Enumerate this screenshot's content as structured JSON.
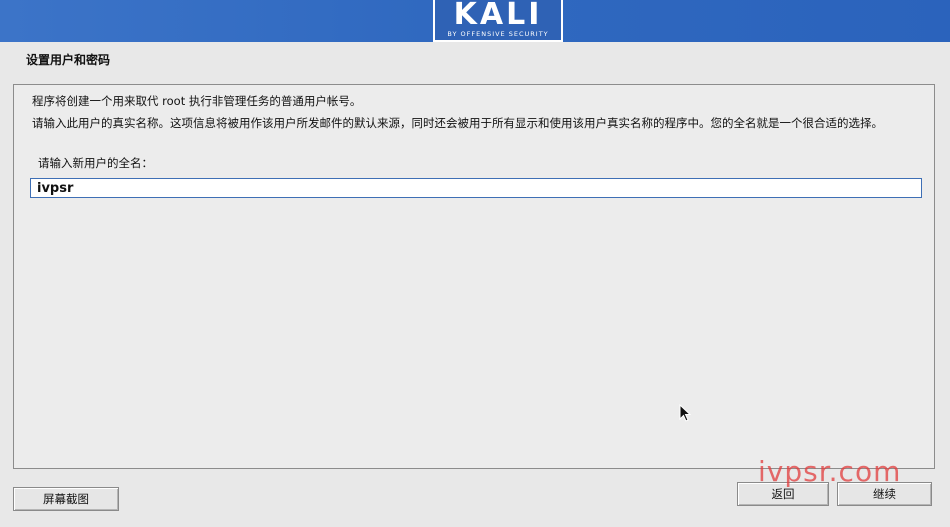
{
  "header": {
    "logo_text": "KALI",
    "logo_subtitle": "BY OFFENSIVE SECURITY"
  },
  "page": {
    "title": "设置用户和密码"
  },
  "content": {
    "intro": "程序将创建一个用来取代 root 执行非管理任务的普通用户帐号。",
    "description": "请输入此用户的真实名称。这项信息将被用作该用户所发邮件的默认来源，同时还会被用于所有显示和使用该用户真实名称的程序中。您的全名就是一个很合适的选择。",
    "field_label": "请输入新用户的全名：",
    "fullname_value": "ivpsr"
  },
  "buttons": {
    "screenshot": "屏幕截图",
    "back": "返回",
    "continue": "继续"
  },
  "watermark": "ivpsr.com",
  "icons": {
    "cursor": "mouse-pointer-icon"
  },
  "colors": {
    "banner": "#3069c0",
    "input_border": "#3e6fb5",
    "watermark": "#e13c3c"
  }
}
